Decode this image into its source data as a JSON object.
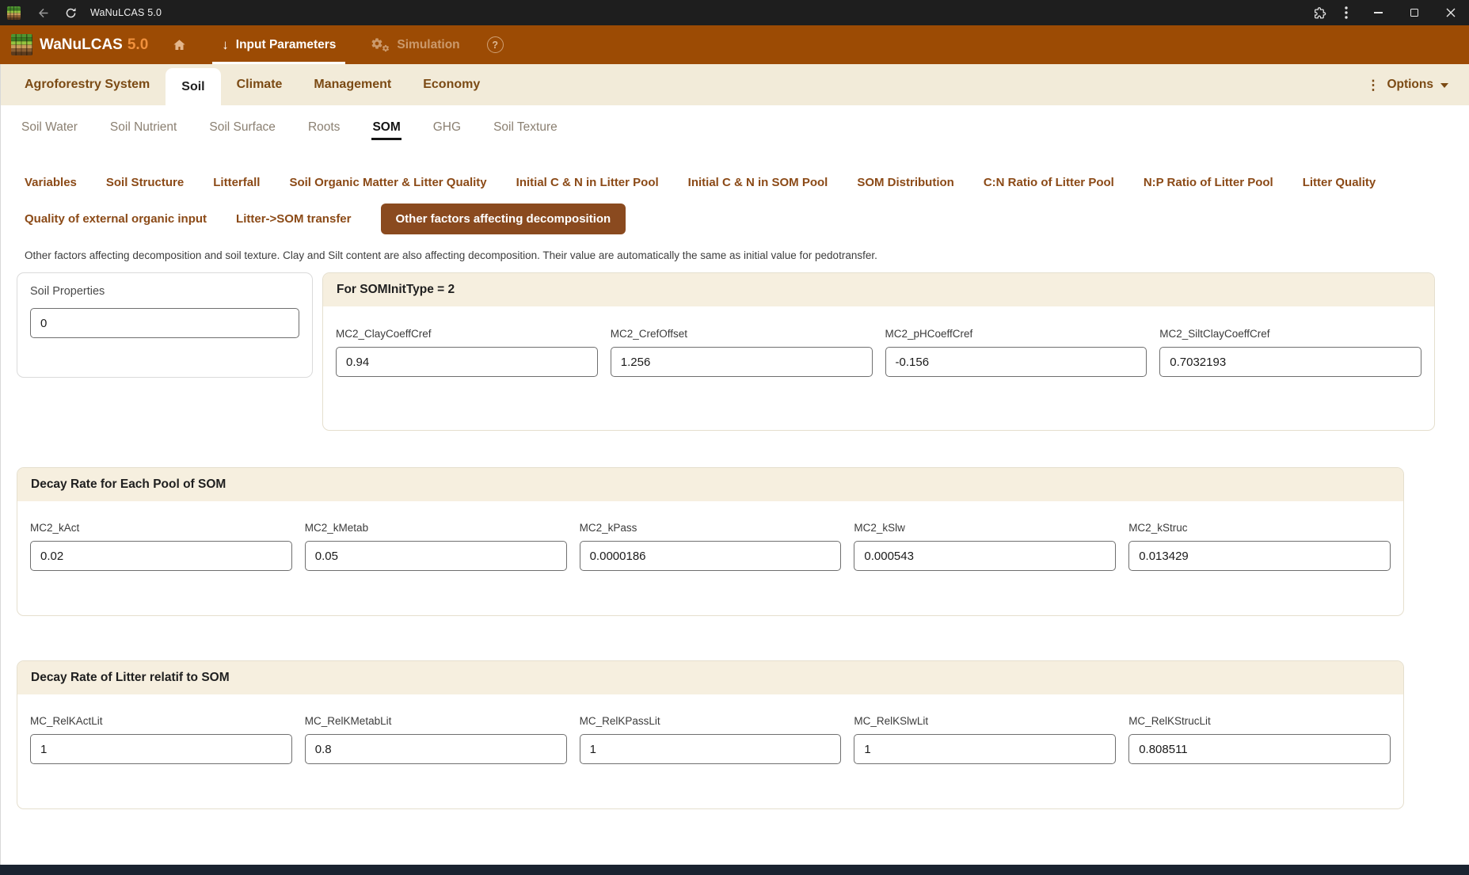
{
  "window": {
    "title": "WaNuLCAS 5.0"
  },
  "header": {
    "brand": "WaNuLCAS",
    "version": "5.0",
    "nav": [
      {
        "label": "Input Parameters",
        "active": true
      },
      {
        "label": "Simulation",
        "active": false
      }
    ]
  },
  "tabs": {
    "items": [
      "Agroforestry System",
      "Soil",
      "Climate",
      "Management",
      "Economy"
    ],
    "active": "Soil",
    "options_label": "Options"
  },
  "subtabs": {
    "items": [
      "Soil Water",
      "Soil Nutrient",
      "Soil Surface",
      "Roots",
      "SOM",
      "GHG",
      "Soil Texture"
    ],
    "active": "SOM"
  },
  "section_nav": {
    "row1": [
      "Variables",
      "Soil Structure",
      "Litterfall",
      "Soil Organic Matter & Litter Quality",
      "Initial C & N in Litter Pool",
      "Initial C & N in SOM Pool",
      "SOM Distribution",
      "C:N Ratio of Litter Pool",
      "N:P Ratio of Litter Pool",
      "Litter Quality"
    ],
    "row2": [
      "Quality of external organic input",
      "Litter->SOM transfer",
      "Other factors affecting decomposition"
    ],
    "active": "Other factors affecting decomposition"
  },
  "description": "Other factors affecting decomposition and soil texture. Clay and Silt content are also affecting decomposition. Their value are automatically the same as initial value for pedotransfer.",
  "panels": {
    "soil_properties": {
      "title": "Soil Properties",
      "value": "0"
    },
    "som_init": {
      "title": "For SOMInitType = 2",
      "fields": [
        {
          "label": "MC2_ClayCoeffCref",
          "value": "0.94"
        },
        {
          "label": "MC2_CrefOffset",
          "value": "1.256"
        },
        {
          "label": "MC2_pHCoeffCref",
          "value": "-0.156"
        },
        {
          "label": "MC2_SiltClayCoeffCref",
          "value": "0.7032193"
        }
      ]
    },
    "decay_som": {
      "title": "Decay Rate for Each Pool of SOM",
      "fields": [
        {
          "label": "MC2_kAct",
          "value": "0.02"
        },
        {
          "label": "MC2_kMetab",
          "value": "0.05"
        },
        {
          "label": "MC2_kPass",
          "value": "0.0000186"
        },
        {
          "label": "MC2_kSlw",
          "value": "0.000543"
        },
        {
          "label": "MC2_kStruc",
          "value": "0.013429"
        }
      ]
    },
    "decay_litter": {
      "title": "Decay Rate of Litter relatif to SOM",
      "fields": [
        {
          "label": "MC_RelKActLit",
          "value": "1"
        },
        {
          "label": "MC_RelKMetabLit",
          "value": "0.8"
        },
        {
          "label": "MC_RelKPassLit",
          "value": "1"
        },
        {
          "label": "MC_RelKSlwLit",
          "value": "1"
        },
        {
          "label": "MC_RelKStrucLit",
          "value": "0.808511"
        }
      ]
    }
  },
  "colors": {
    "header_bg": "#9c4b04",
    "active_button_bg": "#8a4a1f",
    "tab_text_brown": "#7b4a14",
    "cream_bar": "#f2ebd9",
    "panel_header_bg": "#f6efdf",
    "version_orange": "#f0903c",
    "titlebar_bg": "#1e1e1e",
    "bottom_bar": "#1a2330"
  }
}
